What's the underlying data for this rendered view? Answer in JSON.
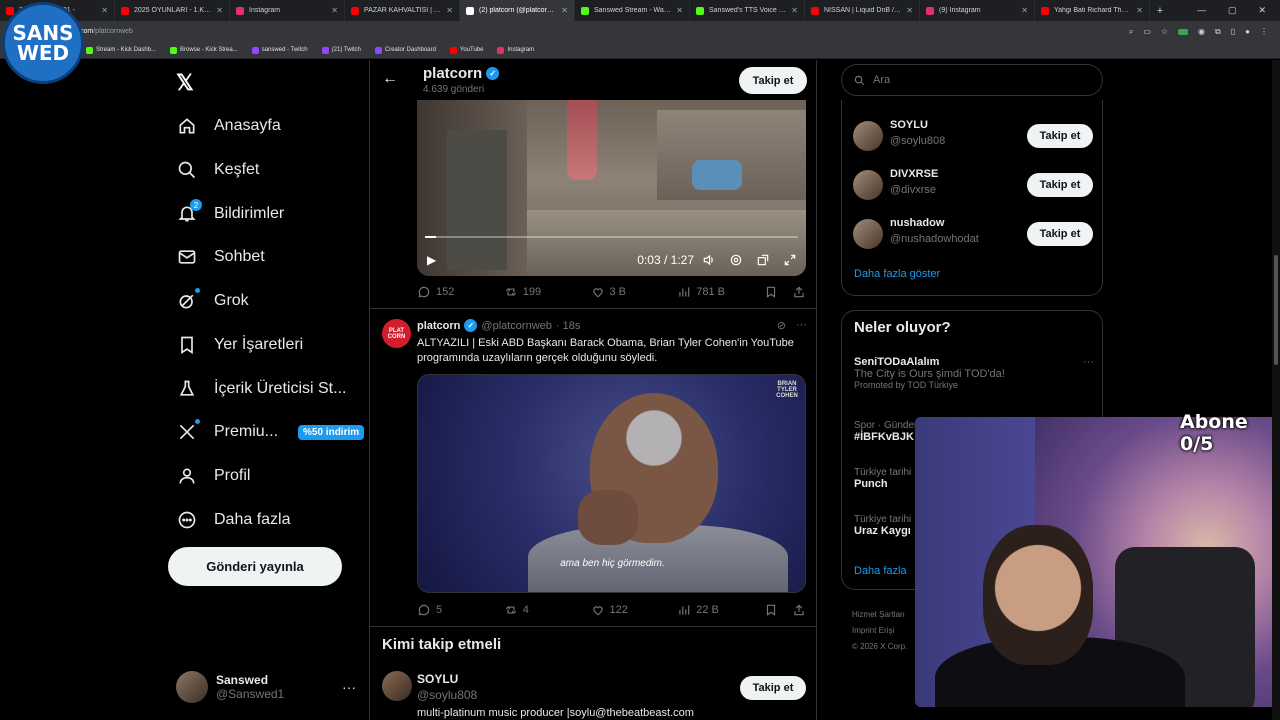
{
  "browser": {
    "tabs": [
      {
        "label": "297 | KÖFTİ #01 -",
        "icon_color": "#ff0000",
        "active": false
      },
      {
        "label": "2025 OYUNLARI - 1.KISIM - Y",
        "icon_color": "#ff0000",
        "active": false
      },
      {
        "label": "Instagram",
        "icon_color": "#e1306c",
        "active": false
      },
      {
        "label": "PAZAR KAHVALTISI | AJDA EN",
        "icon_color": "#ff0000",
        "active": false
      },
      {
        "label": "(2) platcorn (@platcornweb)",
        "icon_color": "#ffffff",
        "active": true
      },
      {
        "label": "Sanswed Stream - Watch Live",
        "icon_color": "#53fc18",
        "active": false
      },
      {
        "label": "Sanswed's TTS Voice List | Kick",
        "icon_color": "#53fc18",
        "active": false
      },
      {
        "label": "NISSAN | Liquid DnB / Jungle",
        "icon_color": "#ff0000",
        "active": false
      },
      {
        "label": "(9) Instagram",
        "icon_color": "#e1306c",
        "active": false
      },
      {
        "label": "Yahgi Bati Richard Thomas - Y",
        "icon_color": "#ff0000",
        "active": false
      }
    ],
    "url_host": "com",
    "url_path": "/platcornweb",
    "bookmarks": [
      {
        "label": "Stream - Kick Dashb...",
        "icon_color": "#53fc18"
      },
      {
        "label": "Browse - Kick Strea...",
        "icon_color": "#53fc18"
      },
      {
        "label": "sanswed - Twitch",
        "icon_color": "#9146ff"
      },
      {
        "label": "(21) Twitch",
        "icon_color": "#9146ff"
      },
      {
        "label": "Creator Dashboard",
        "icon_color": "#9146ff"
      },
      {
        "label": "YouTube",
        "icon_color": "#ff0000"
      },
      {
        "label": "Instagram",
        "icon_color": "#e1306c"
      }
    ]
  },
  "overlay": {
    "logo_line1": "SANS",
    "logo_line2": "WED",
    "subs": "Abone 0/5"
  },
  "nav": {
    "items": [
      {
        "label": "Anasayfa",
        "icon": "home-icon"
      },
      {
        "label": "Keşfet",
        "icon": "search-icon"
      },
      {
        "label": "Bildirimler",
        "icon": "bell-icon",
        "badge": "2"
      },
      {
        "label": "Sohbet",
        "icon": "mail-icon"
      },
      {
        "label": "Grok",
        "icon": "grok-icon"
      },
      {
        "label": "Yer İşaretleri",
        "icon": "bookmark-icon"
      },
      {
        "label": "İçerik Üreticisi St...",
        "icon": "flask-icon"
      },
      {
        "label": "Premiu...",
        "icon": "x-premium-icon",
        "promo": "%50 indirim"
      },
      {
        "label": "Profil",
        "icon": "person-icon"
      },
      {
        "label": "Daha fazla",
        "icon": "more-circle-icon"
      }
    ],
    "post_button": "Gönderi yayınla",
    "account": {
      "name": "Sanswed",
      "handle": "@Sanswed1",
      "more": "···"
    }
  },
  "profile_header": {
    "name": "platcorn",
    "post_count": "4.639 gönderi",
    "follow": "Takip et"
  },
  "tweet1": {
    "video_time": "0:03 / 1:27",
    "video_progress": 0.03,
    "replies": "152",
    "reposts": "199",
    "likes": "3 B",
    "views": "781 B"
  },
  "tweet2": {
    "avatar_text": "PLAT CORN",
    "name": "platcorn",
    "handle": "@platcornweb",
    "time": "· 18s",
    "text": "ALTYAZILI | Eski ABD Başkanı Barack Obama, Brian Tyler Cohen'in YouTube programında uzaylıların gerçek olduğunu söyledi.",
    "video_corner": "BRIAN TYLER COHEN",
    "subtitle": "ama ben hiç görmedim.",
    "replies": "5",
    "reposts": "4",
    "likes": "122",
    "views": "22 B"
  },
  "who_to_follow_main": {
    "title": "Kimi takip etmeli",
    "name": "SOYLU",
    "handle": "@soylu808",
    "follow": "Takip et",
    "bio": "multi-platinum music producer |soylu@thebeatbeast.com"
  },
  "right": {
    "search_placeholder": "Ara",
    "suggestions": [
      {
        "name": "SOYLU",
        "handle": "@soylu808",
        "follow": "Takip et"
      },
      {
        "name": "DIVXRSE",
        "handle": "@divxrse",
        "follow": "Takip et"
      },
      {
        "name": "nushadow",
        "handle": "@nushadowhodat",
        "follow": "Takip et"
      }
    ],
    "show_more": "Daha fazla göster",
    "trends_title": "Neler oluyor?",
    "trends": [
      {
        "meta": "",
        "name": "SeniTODaAlalım",
        "desc": "The City is Ours şimdi TOD'da!",
        "promo": "Promoted by TOD Türkiye"
      },
      {
        "meta": "Spor · Gündemde",
        "name": "#İBFKvBJK",
        "desc": "",
        "promo": ""
      },
      {
        "meta": "Türkiye tarihi",
        "name": "Punch",
        "desc": "",
        "promo": ""
      },
      {
        "meta": "Türkiye tarihi",
        "name": "Uraz Kaygı",
        "desc": "",
        "promo": ""
      }
    ],
    "trends_more": "Daha fazla",
    "footer_line1": "Hizmet Şartları",
    "footer_line2": "Imprint   Erişi",
    "footer_line3": "© 2026 X Corp."
  }
}
